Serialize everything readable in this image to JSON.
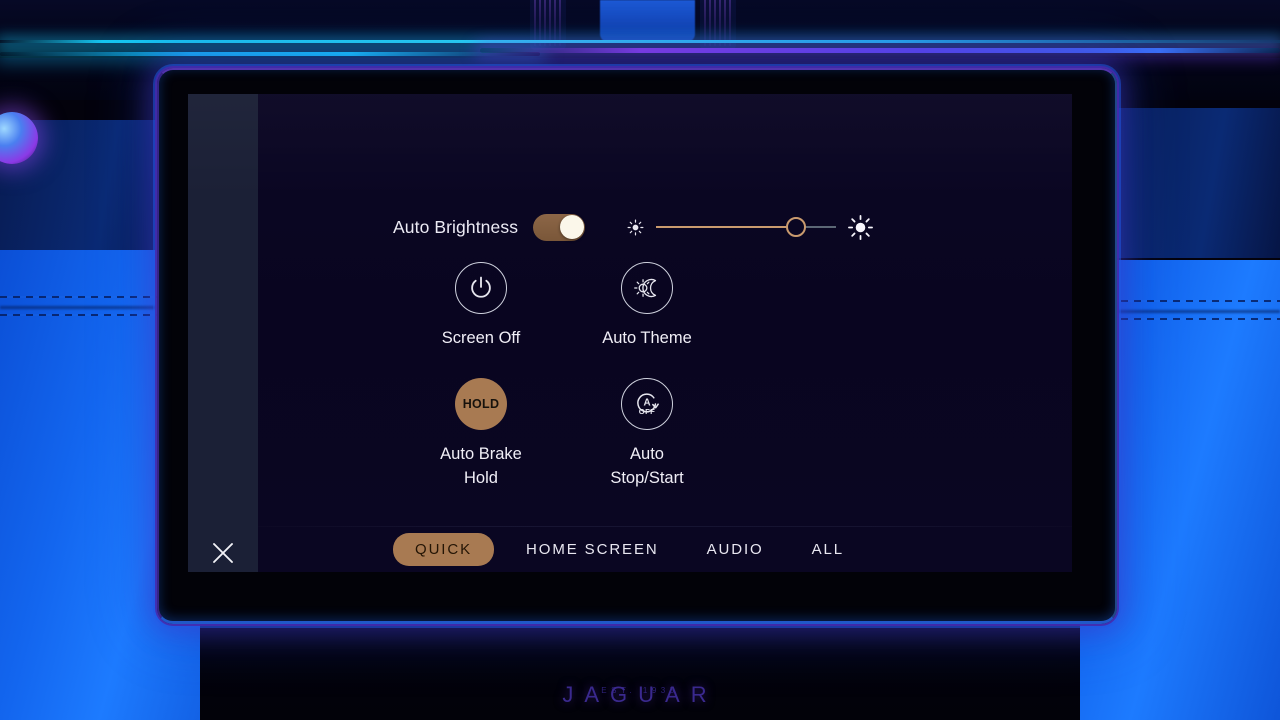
{
  "vehicle": {
    "brand": "JAGUAR",
    "established": "EST. 1935"
  },
  "screen": {
    "brightness": {
      "label": "Auto Brightness",
      "toggle_state": "on",
      "toggle_name": "auto-brightness-toggle",
      "slider": {
        "name": "brightness-slider",
        "value_percent": 78,
        "min_icon": "sun-dim-icon",
        "max_icon": "sun-bright-icon"
      }
    },
    "tiles": [
      {
        "id": "screen-off",
        "label": "Screen Off",
        "icon": "power-icon",
        "style": "outline"
      },
      {
        "id": "auto-theme",
        "label": "Auto Theme",
        "icon": "sun-moon-icon",
        "style": "outline"
      },
      {
        "id": "auto-brake-hold",
        "label": "Auto Brake\nHold",
        "icon": "hold-icon",
        "style": "filled",
        "icon_text": "HOLD"
      },
      {
        "id": "auto-stop-start",
        "label": "Auto\nStop/Start",
        "icon": "auto-stop-icon",
        "style": "outline",
        "icon_text": "OFF"
      }
    ],
    "tabs": [
      {
        "id": "quick",
        "label": "QUICK",
        "active": true
      },
      {
        "id": "home-screen",
        "label": "HOME SCREEN",
        "active": false
      },
      {
        "id": "audio",
        "label": "AUDIO",
        "active": false
      },
      {
        "id": "all",
        "label": "ALL",
        "active": false
      }
    ],
    "close_button": {
      "name": "close-button",
      "icon": "close-x-icon"
    }
  },
  "colors": {
    "accent_copper": "#a87a52",
    "slider_fill": "#c99a6e",
    "screen_bg": "#0a0622",
    "sidebar": "#1b2036",
    "text_primary": "#f0eef6",
    "ambient_cyan": "#2fe3f7",
    "ambient_violet": "#8c3ce8",
    "leather_blue": "#1366ef",
    "logo_purple": "#3b2a8f"
  }
}
